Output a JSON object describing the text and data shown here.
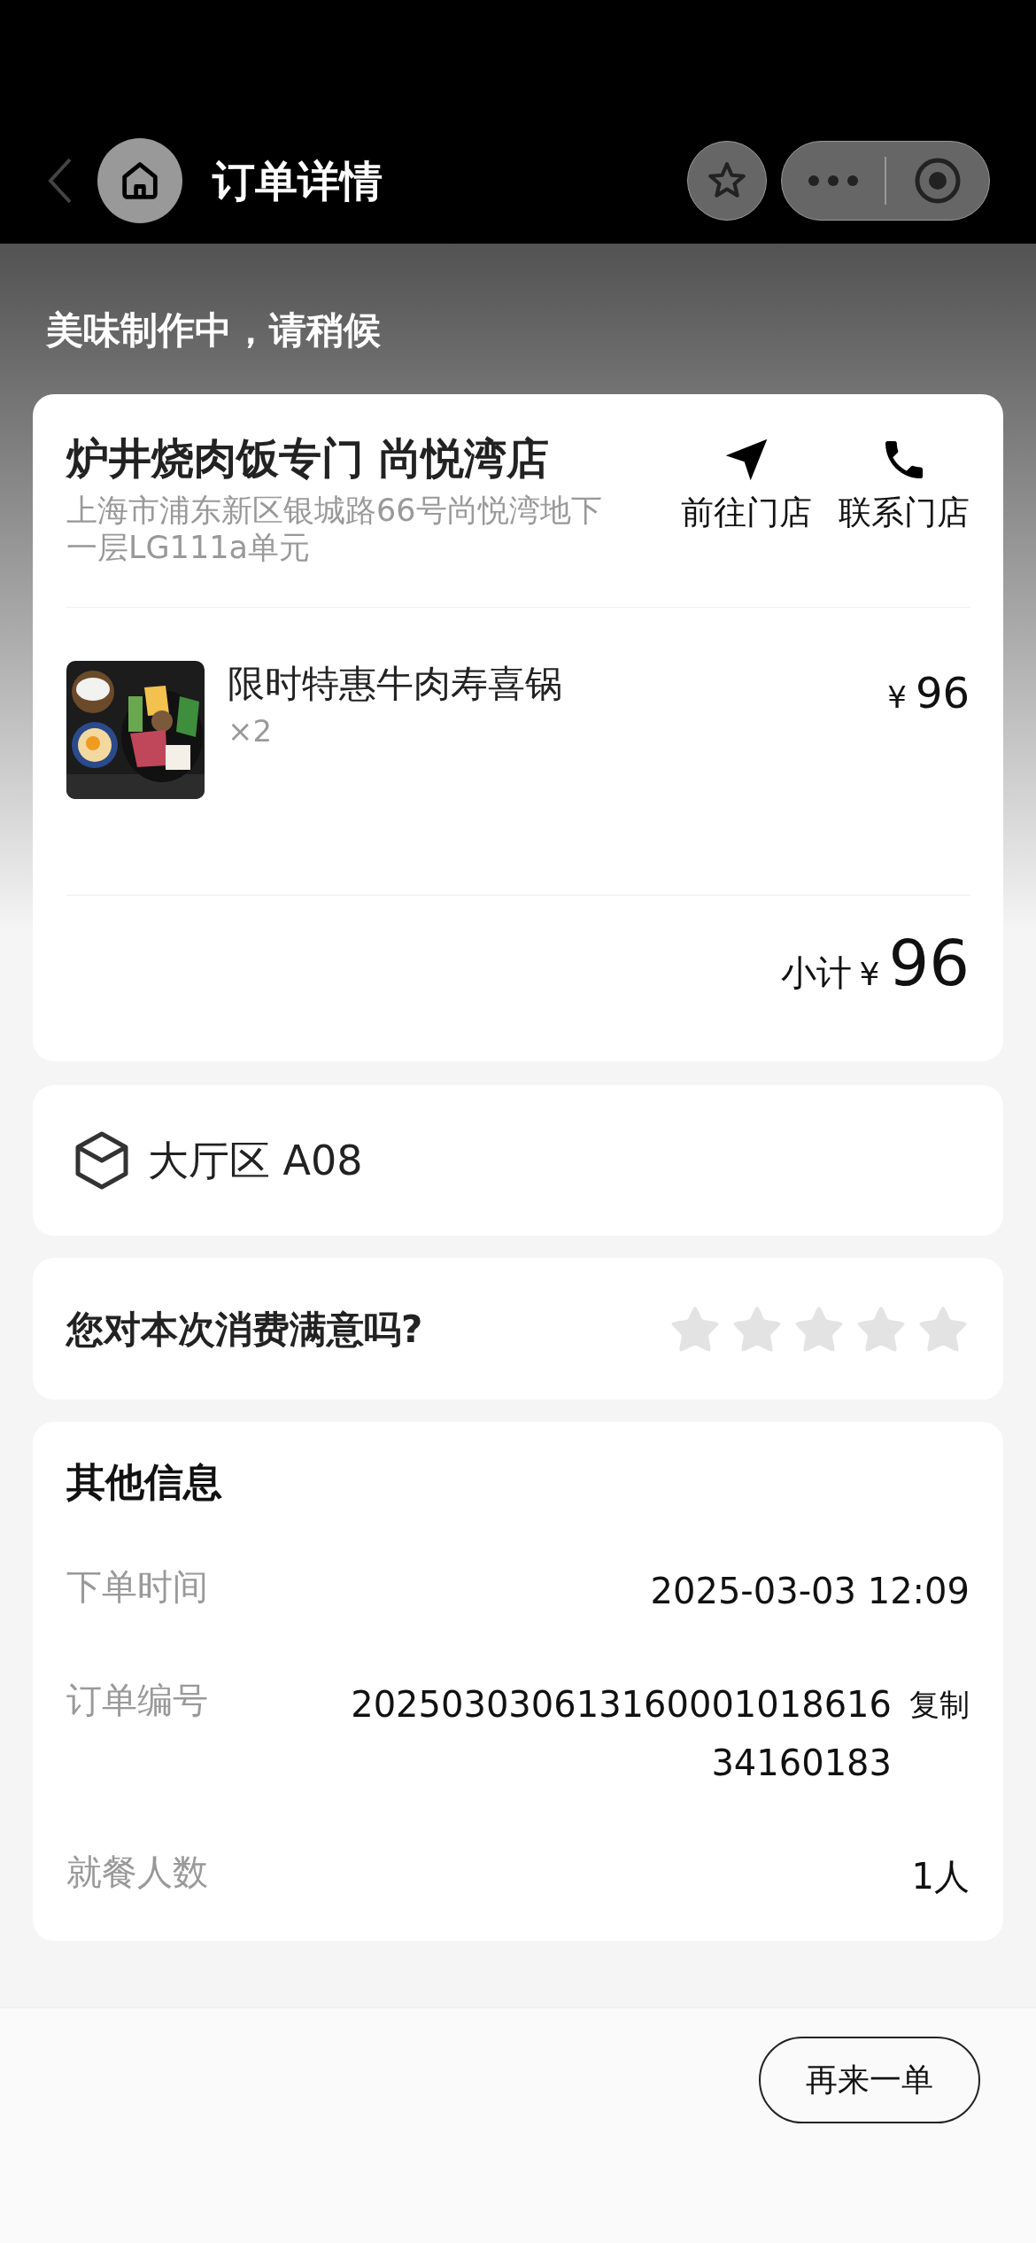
{
  "nav": {
    "title": "订单详情"
  },
  "status": {
    "subtitle": "美味制作中，请稍候"
  },
  "store": {
    "name": "炉井烧肉饭专门 尚悦湾店",
    "address": "上海市浦东新区银城路66号尚悦湾地下一层LG111a单元",
    "actions": [
      {
        "kind": "navigate",
        "label": "前往门店"
      },
      {
        "kind": "call",
        "label": "联系门店"
      }
    ]
  },
  "items": [
    {
      "kind": "picture",
      "name": "限时特惠牛肉寿喜锅",
      "quantity": "×2",
      "currency": "¥",
      "price": "96"
    }
  ],
  "subtotal": {
    "label": "小计",
    "currency": "¥",
    "amount": "96"
  },
  "table": {
    "label": "大厅区 A08"
  },
  "rating": {
    "question": "您对本次消费满意吗?",
    "stars": 0
  },
  "other_info": {
    "title": "其他信息",
    "rows": [
      {
        "label": "下单时间",
        "value": "2025-03-03 12:09"
      },
      {
        "label": "订单编号",
        "value": "20250303061316000101861634160183",
        "action": "复制"
      },
      {
        "label": "就餐人数",
        "value": "1人"
      }
    ]
  },
  "footer": {
    "button": "再来一单"
  }
}
